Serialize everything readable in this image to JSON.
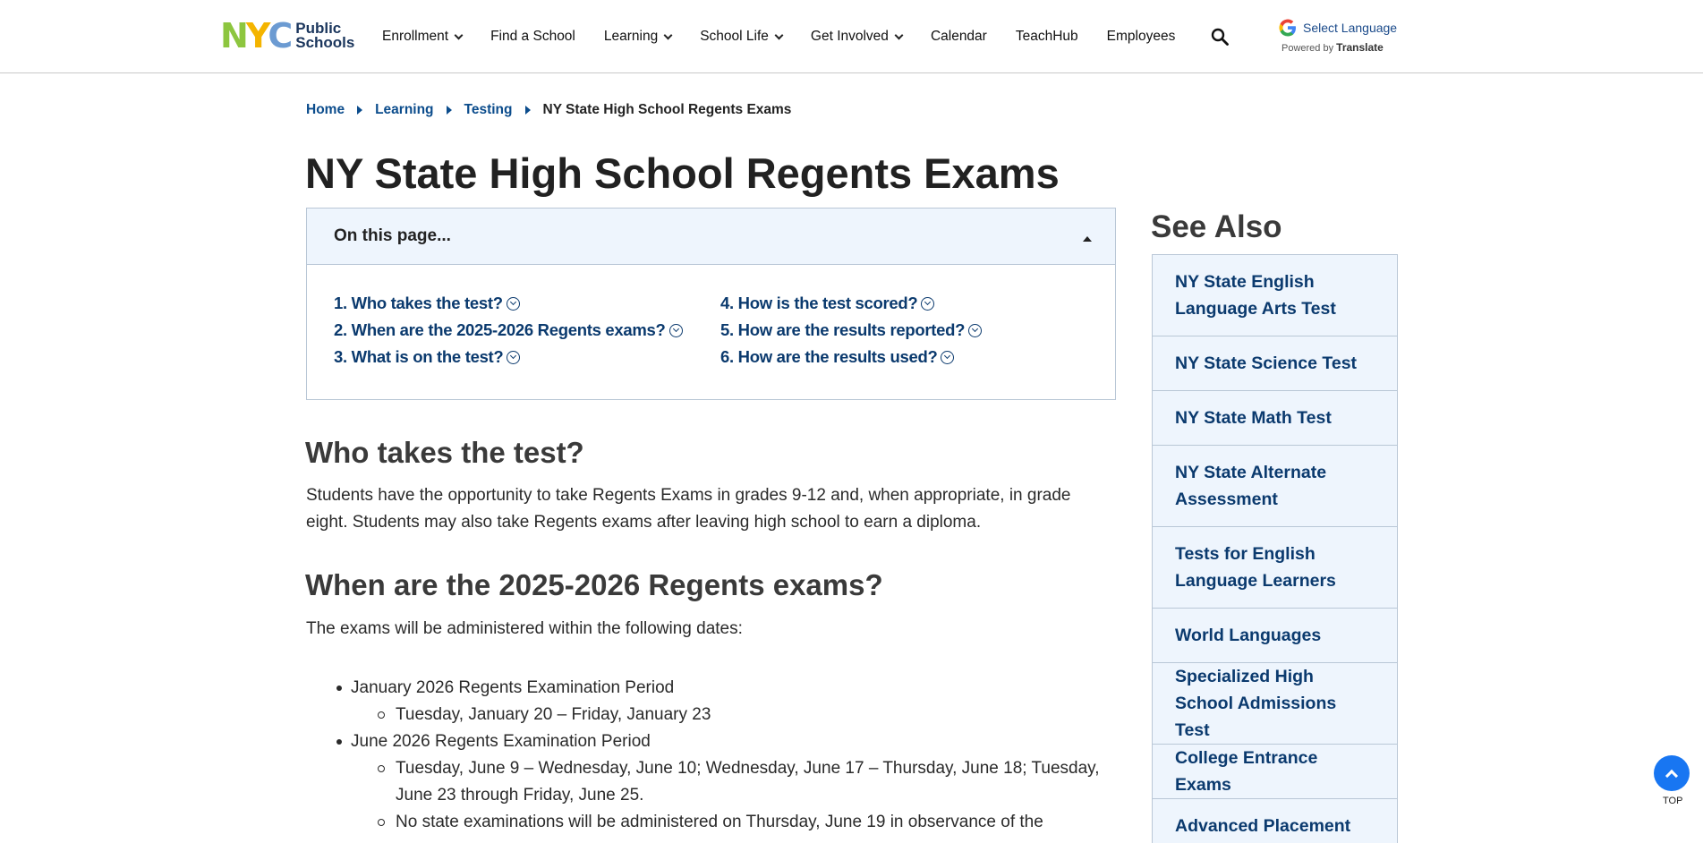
{
  "header": {
    "logo_text_line1": "Public",
    "logo_text_line2": "Schools",
    "nav": [
      {
        "label": "Enrollment",
        "dropdown": true
      },
      {
        "label": "Find a School",
        "dropdown": false
      },
      {
        "label": "Learning",
        "dropdown": true
      },
      {
        "label": "School Life",
        "dropdown": true
      },
      {
        "label": "Get Involved",
        "dropdown": true
      },
      {
        "label": "Calendar",
        "dropdown": false
      },
      {
        "label": "TeachHub",
        "dropdown": false
      },
      {
        "label": "Employees",
        "dropdown": false
      }
    ],
    "translate_label": "Select Language",
    "powered_by": "Powered by",
    "translate_word": "Translate"
  },
  "breadcrumb": {
    "items": [
      "Home",
      "Learning",
      "Testing"
    ],
    "current": "NY State High School Regents Exams"
  },
  "page_title": "NY State High School Regents Exams",
  "toc": {
    "heading": "On this page...",
    "items": [
      "1. Who takes the test?",
      "4. How is the test scored?",
      "2. When are the 2025-2026 Regents exams?",
      "5. How are the results reported?",
      "3. What is on the test?",
      "6. How are the results used?"
    ]
  },
  "content": {
    "section1_title": "Who takes the test?",
    "section1_body": "Students have the opportunity to take Regents Exams in grades 9-12 and, when appropriate, in grade eight. Students may also take Regents exams after leaving high school to earn a diploma.",
    "section2_title": "When are the 2025-2026 Regents exams?",
    "section2_intro": "The exams will be administered within the following dates:",
    "periods": [
      {
        "label": "January 2026 Regents Examination Period",
        "dates": [
          "Tuesday, January 20 – Friday, January 23"
        ]
      },
      {
        "label": "June 2026 Regents Examination Period",
        "dates": [
          "Tuesday, June 9 – Wednesday, June 10; Wednesday, June 17 – Thursday, June 18; Tuesday, June 23 through Friday, June 25.",
          "No state examinations will be administered on Thursday, June 19 in observance of the"
        ]
      }
    ]
  },
  "see_also": {
    "title": "See Also",
    "items": [
      "NY State English Language Arts Test",
      "NY State Science Test",
      "NY State Math Test",
      "NY State Alternate Assessment",
      "Tests for English Language Learners",
      "World Languages",
      "Specialized High School Admissions Test",
      "College Entrance Exams",
      "Advanced Placement"
    ]
  },
  "back_to_top": "TOP",
  "colors": {
    "link": "#0b3a6e",
    "panel_bg": "#eef5fd",
    "top_button": "#1876f2"
  }
}
